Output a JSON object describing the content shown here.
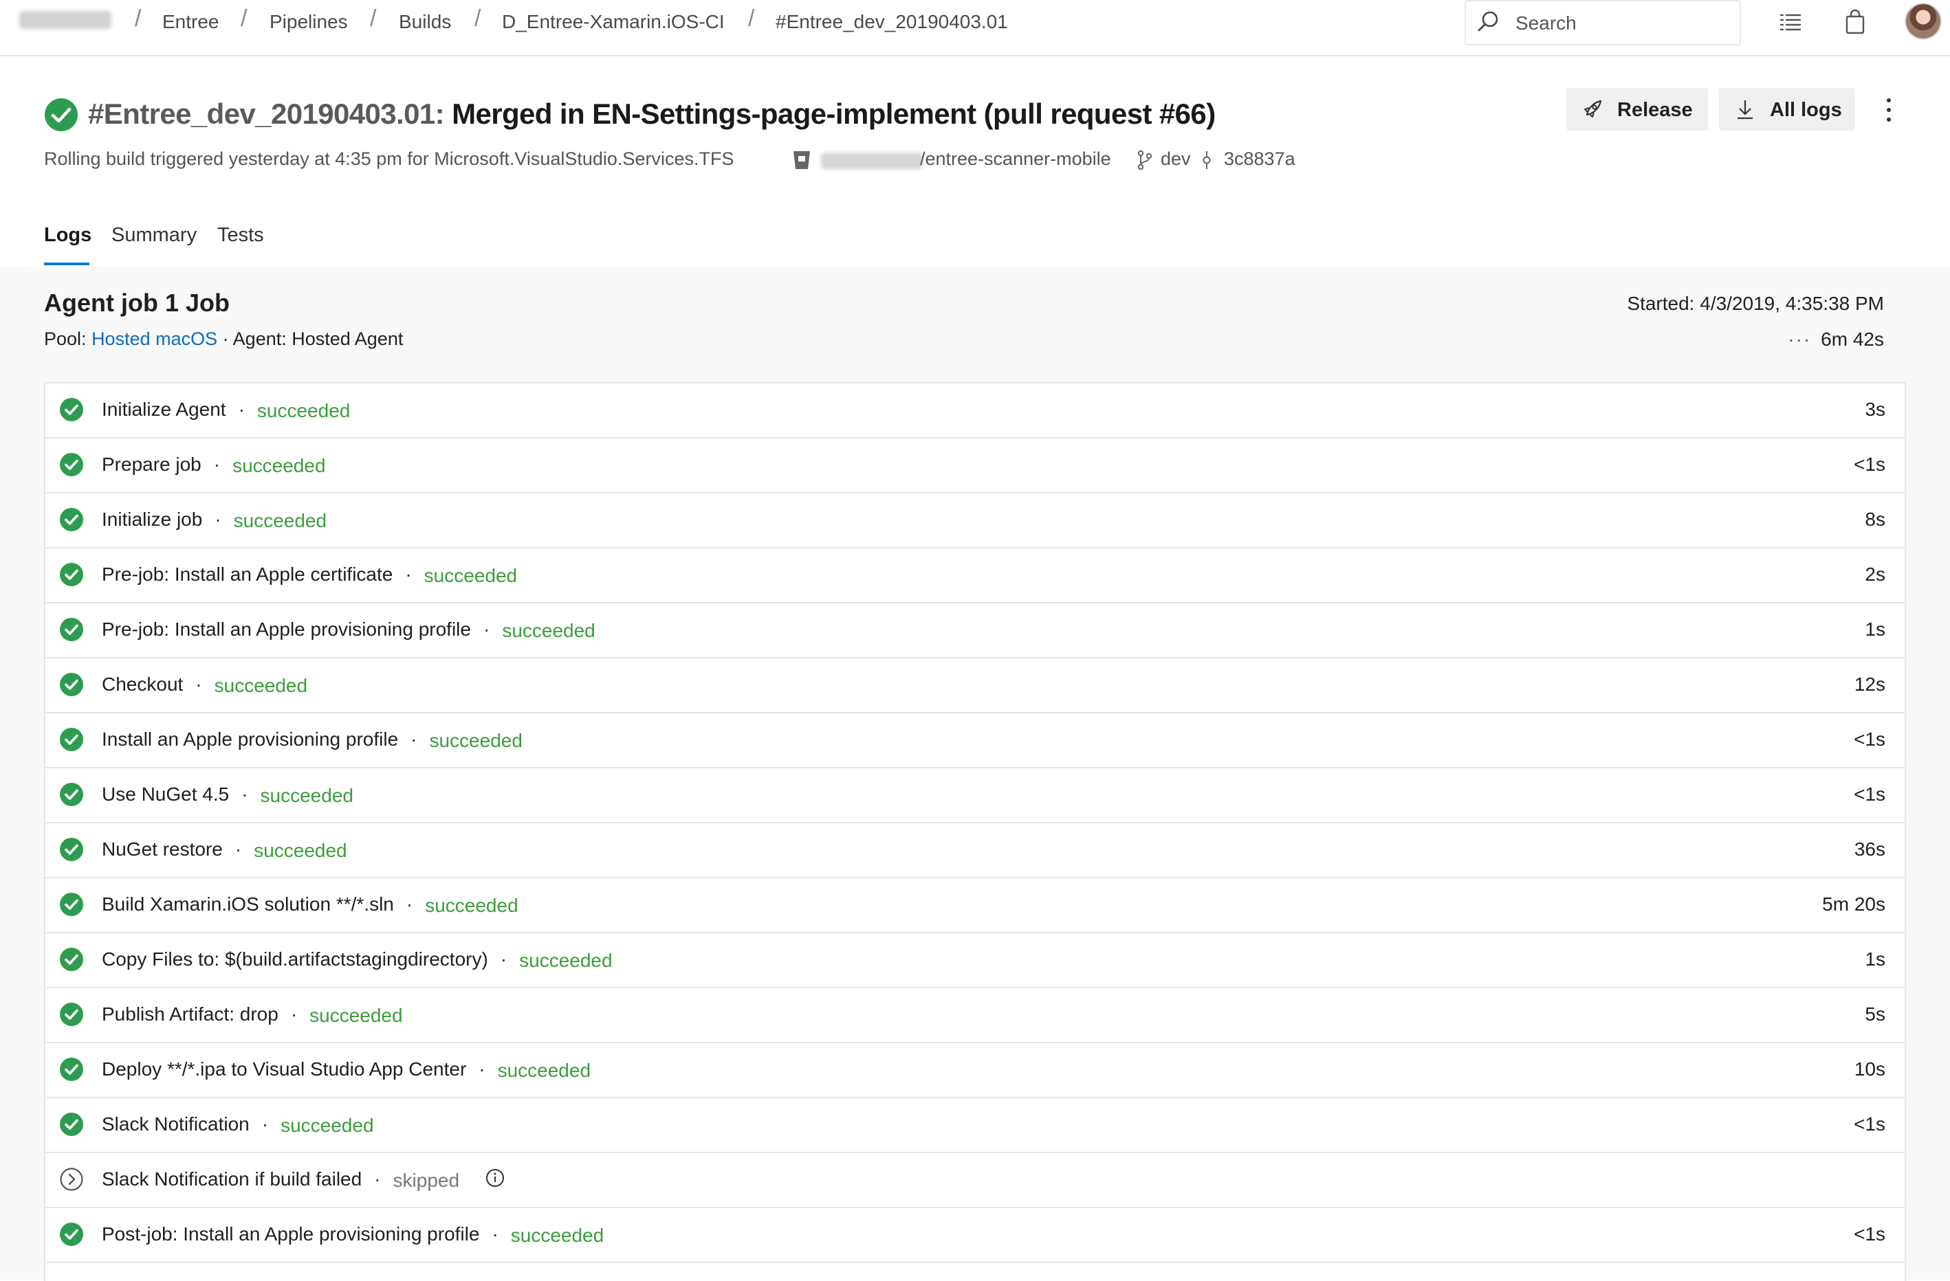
{
  "breadcrumb": {
    "items": [
      "Entree",
      "Pipelines",
      "Builds",
      "D_Entree-Xamarin.iOS-CI",
      "#Entree_dev_20190403.01"
    ]
  },
  "search": {
    "placeholder": "Search"
  },
  "icons": {
    "search": "search-icon",
    "list": "task-list-icon",
    "bag": "marketplace-bag-icon",
    "rocket": "rocket-icon",
    "download": "download-icon",
    "more": "more-vertical-icon",
    "check": "check-circle-icon",
    "skipped": "skipped-chevron-circle-icon",
    "info": "info-icon",
    "branch": "branch-icon",
    "commit": "commit-icon",
    "repo": "repository-icon"
  },
  "colors": {
    "success": "#3c9d3c",
    "success_icon": "#2e9c4f",
    "link": "#0c6bbf",
    "accent": "#0078d4",
    "skipped": "#777777"
  },
  "header": {
    "build_number": "#Entree_dev_20190403.01:",
    "title": " Merged in EN-Settings-page-implement (pull request #66)",
    "subtitle": "Rolling build triggered yesterday at 4:35 pm for Microsoft.VisualStudio.Services.TFS",
    "repo": "/entree-scanner-mobile",
    "branch": "dev",
    "commit": "3c8837a",
    "release_label": "Release",
    "all_logs_label": "All logs"
  },
  "tabs": [
    {
      "label": "Logs",
      "active": true
    },
    {
      "label": "Summary",
      "active": false
    },
    {
      "label": "Tests",
      "active": false
    }
  ],
  "job": {
    "title": "Agent job 1 Job",
    "pool_label": "Pool:",
    "pool_name": "Hosted macOS",
    "separator": "·",
    "agent": "Agent: Hosted Agent",
    "started": "Started: 4/3/2019, 4:35:38 PM",
    "duration_dots": "···",
    "duration": "6m 42s"
  },
  "steps": [
    {
      "name": "Initialize Agent",
      "status": "succeeded",
      "duration": "3s"
    },
    {
      "name": "Prepare job",
      "status": "succeeded",
      "duration": "<1s"
    },
    {
      "name": "Initialize job",
      "status": "succeeded",
      "duration": "8s"
    },
    {
      "name": "Pre-job: Install an Apple certificate",
      "status": "succeeded",
      "duration": "2s"
    },
    {
      "name": "Pre-job: Install an Apple provisioning profile",
      "status": "succeeded",
      "duration": "1s"
    },
    {
      "name": "Checkout",
      "status": "succeeded",
      "duration": "12s"
    },
    {
      "name": "Install an Apple provisioning profile",
      "status": "succeeded",
      "duration": "<1s"
    },
    {
      "name": "Use NuGet 4.5",
      "status": "succeeded",
      "duration": "<1s"
    },
    {
      "name": "NuGet restore",
      "status": "succeeded",
      "duration": "36s"
    },
    {
      "name": "Build Xamarin.iOS solution **/*.sln",
      "status": "succeeded",
      "duration": "5m 20s"
    },
    {
      "name": "Copy Files to: $(build.artifactstagingdirectory)",
      "status": "succeeded",
      "duration": "1s"
    },
    {
      "name": "Publish Artifact: drop",
      "status": "succeeded",
      "duration": "5s"
    },
    {
      "name": "Deploy **/*.ipa to Visual Studio App Center",
      "status": "succeeded",
      "duration": "10s"
    },
    {
      "name": "Slack Notification",
      "status": "succeeded",
      "duration": "<1s"
    },
    {
      "name": "Slack Notification if build failed",
      "status": "skipped",
      "duration": ""
    },
    {
      "name": "Post-job: Install an Apple provisioning profile",
      "status": "succeeded",
      "duration": "<1s"
    }
  ]
}
